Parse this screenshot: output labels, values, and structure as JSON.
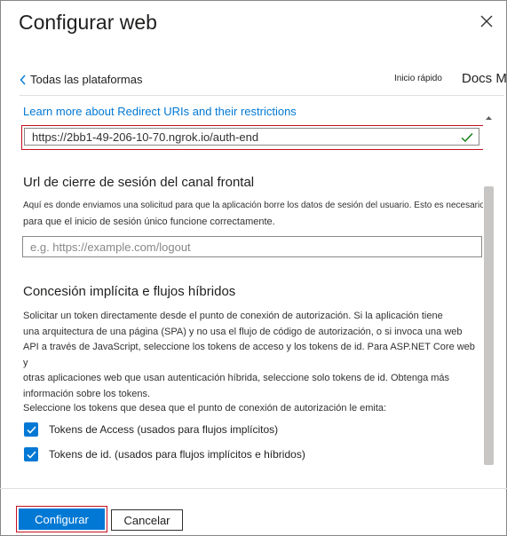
{
  "dialog": {
    "title": "Configurar web"
  },
  "nav": {
    "back_label": "Todas las plataformas",
    "quickstart_label": "Inicio rápido",
    "docs_label": "Docs M"
  },
  "redirect": {
    "link_text": "Learn more about Redirect URIs and their restrictions",
    "uri_value": "https://2bb1-49-206-10-70.ngrok.io/auth-end"
  },
  "front_channel": {
    "heading": "Url de cierre de sesión del canal frontal",
    "description_line1": "Aquí es donde enviamos una solicitud para que la aplicación borre los datos de sesión del usuario. Esto es necesario",
    "description_line2": "para que el inicio de sesión único funcione correctamente.",
    "placeholder": "e.g. https://example.com/logout"
  },
  "implicit": {
    "heading": "Concesión implícita e flujos híbridos",
    "description": [
      "Solicitar un token directamente desde el punto de conexión de autorización. Si la aplicación tiene",
      "una arquitectura de una página (SPA) y no usa el flujo de código de autorización, o si invoca una web",
      "API a través de JavaScript, seleccione los tokens de acceso y los tokens de id. Para ASP.NET Core web y",
      "otras aplicaciones web que usan autenticación híbrida, seleccione solo tokens de id. Obtenga más",
      "información sobre los tokens."
    ],
    "select_prompt": "Seleccione los tokens que desea que el punto de conexión de autorización le emita:",
    "checkboxes": [
      {
        "label": "Tokens de Access (usados para flujos implícitos)",
        "checked": true
      },
      {
        "label": "Tokens de id. (usados para flujos implícitos e híbridos)",
        "checked": true
      }
    ]
  },
  "footer": {
    "primary_label": "Configurar",
    "secondary_label": "Cancelar"
  },
  "colors": {
    "accent": "#0078d4",
    "highlight_border": "#c50f1f"
  }
}
